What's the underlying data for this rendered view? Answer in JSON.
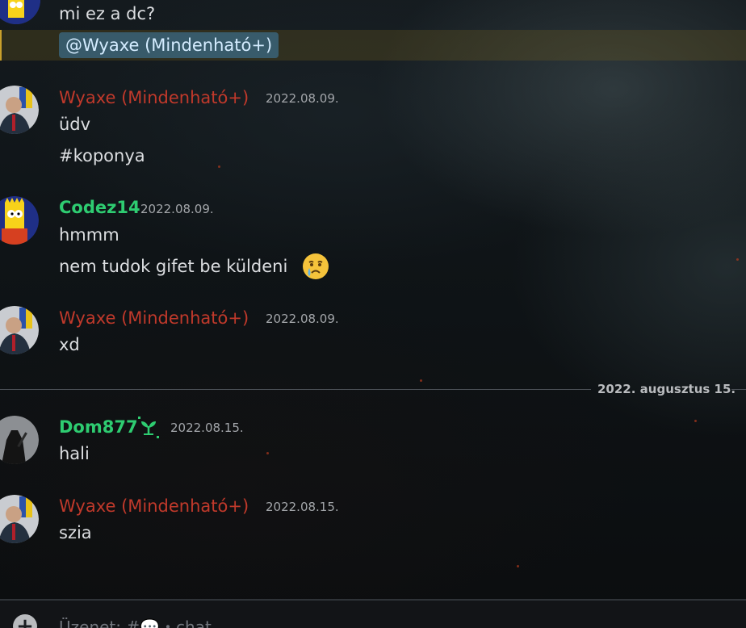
{
  "messages": [
    {
      "type": "continuation",
      "text": "mi ez a dc?",
      "mention": "@Wyaxe (Mindenható+)"
    },
    {
      "author": "Wyaxe (Mindenható+)",
      "timestamp": "2022.08.09.",
      "lines": [
        "üdv",
        "#koponya"
      ]
    },
    {
      "author": "Codez14",
      "timestamp": "2022.08.09.",
      "lines": [
        "hmmm",
        "nem tudok gifet be küldeni"
      ],
      "emoji": "😢"
    },
    {
      "author": "Wyaxe (Mindenható+)",
      "timestamp": "2022.08.09.",
      "lines": [
        "xd"
      ]
    },
    {
      "author": "Dom877",
      "timestamp": "2022.08.15.",
      "lines": [
        "hali"
      ],
      "badge_icon": "sprout-icon"
    },
    {
      "author": "Wyaxe (Mindenható+)",
      "timestamp": "2022.08.15.",
      "lines": [
        "szia"
      ]
    }
  ],
  "date_divider": "2022. augusztus 15.",
  "composer": {
    "placeholder": "Üzenet: #💬・chat"
  },
  "colors": {
    "admin_red": "#c0392b",
    "member_green": "#2ecc71",
    "mention_bg": "#4080aa",
    "highlight_border": "#c9a02b"
  }
}
